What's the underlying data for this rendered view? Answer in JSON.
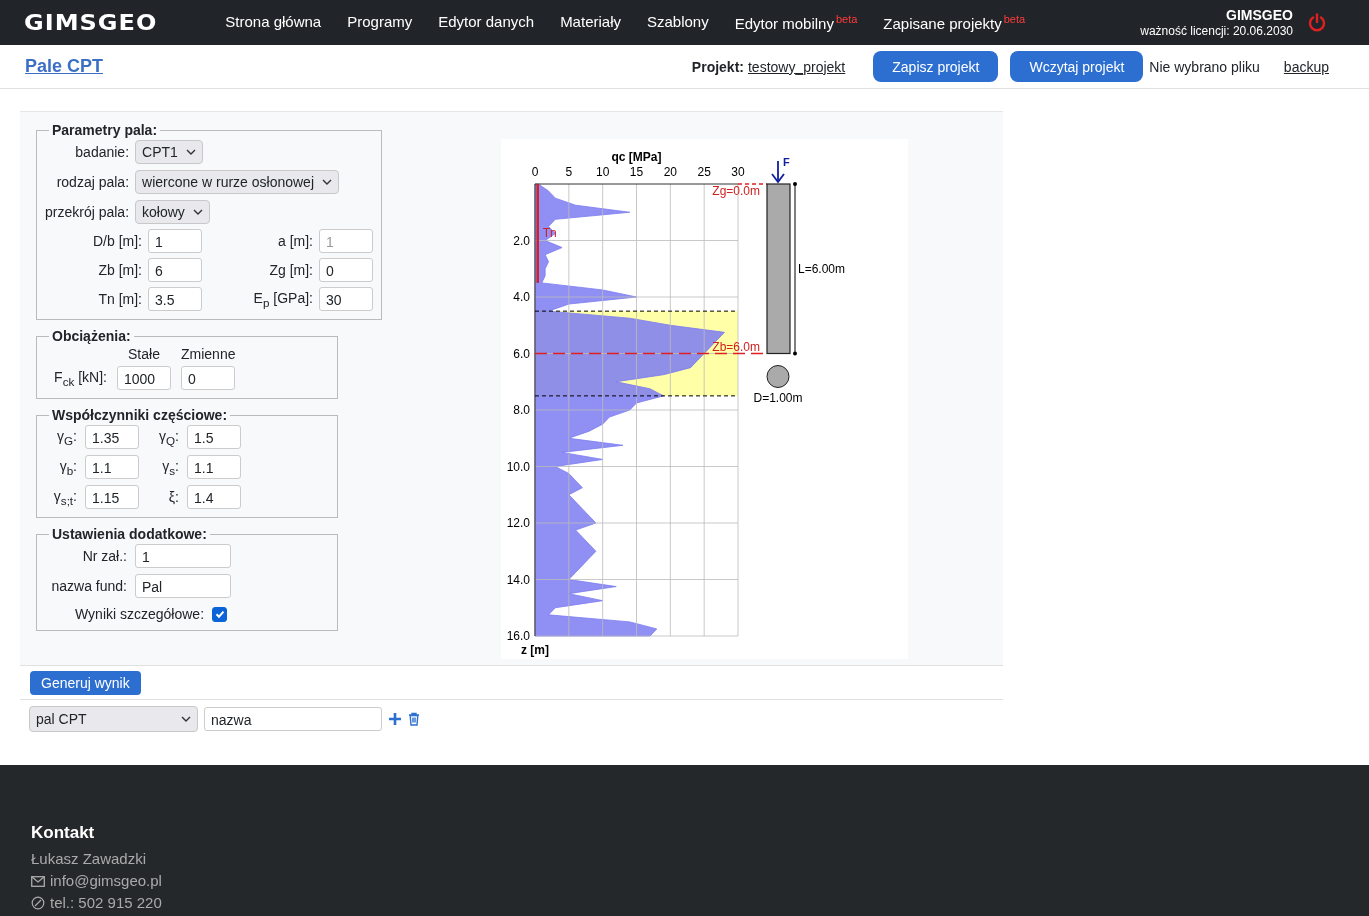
{
  "header": {
    "logo": "GIMSGEO",
    "nav": [
      {
        "label": "Strona główna"
      },
      {
        "label": "Programy"
      },
      {
        "label": "Edytor danych"
      },
      {
        "label": "Materiały"
      },
      {
        "label": "Szablony"
      },
      {
        "label": "Edytor mobilny",
        "badge": "beta"
      },
      {
        "label": "Zapisane projekty",
        "badge": "beta"
      }
    ],
    "user": "GIMSGEO",
    "license": "ważność licencji: 20.06.2030"
  },
  "toolbar": {
    "title": "Pale CPT",
    "project_label": "Projekt:",
    "project_name": "testowy_projekt",
    "buttons": [
      "Zapisz projekt",
      "Wczytaj projekt"
    ],
    "file_status": "Nie wybrano pliku",
    "backup_link": "backup"
  },
  "pile_params": {
    "legend": "Parametry pala:",
    "selects": [
      {
        "label": "badanie:",
        "value": "CPT1"
      },
      {
        "label": "rodzaj pala:",
        "value": "wiercone w rurze osłonowej"
      },
      {
        "label": "przekrój pala:",
        "value": "kołowy"
      }
    ],
    "fields": [
      {
        "label": "D/b [m]:",
        "value": "1",
        "disabled": false
      },
      {
        "label": "a [m]:",
        "value": "1",
        "disabled": true
      },
      {
        "label": "Zb [m]:",
        "value": "6",
        "disabled": false
      },
      {
        "label": "Zg [m]:",
        "value": "0",
        "disabled": false
      },
      {
        "label": "Tn [m]:",
        "value": "3.5",
        "disabled": false
      },
      {
        "label": "E$_{p}$ [GPa]:",
        "value": "30",
        "disabled": false
      }
    ]
  },
  "loads": {
    "legend": "Obciążenia:",
    "columns": [
      "Stałe",
      "Zmienne"
    ],
    "label": "F$_{ck}$ [kN]:",
    "values": [
      "1000",
      "0"
    ]
  },
  "factors": {
    "legend": "Współczynniki częściowe:",
    "fields": [
      {
        "label": "γ$_{G}$:",
        "value": "1.35"
      },
      {
        "label": "γ$_{Q}$:",
        "value": "1.5"
      },
      {
        "label": "γ$_{b}$:",
        "value": "1.1"
      },
      {
        "label": "γ$_{s}$:",
        "value": "1.1"
      },
      {
        "label": "γ$_{s;t}$:",
        "value": "1.15"
      },
      {
        "label": "ξ:",
        "value": "1.4"
      }
    ]
  },
  "extra": {
    "legend": "Ustawienia dodatkowe:",
    "fields": [
      {
        "label": "Nr zał.:",
        "value": "1"
      },
      {
        "label": "nazwa fund:",
        "value": "Pal"
      }
    ],
    "checkbox": {
      "label": "Wyniki szczegółowe:",
      "checked": true
    }
  },
  "generate_button": "Generuj wynik",
  "saved_results": {
    "select": "pal CPT",
    "name": "nazwa"
  },
  "chart": {
    "chart_data": {
      "type": "area",
      "orientation": "horizontal",
      "xlabel": "qc [MPa]",
      "ylabel": "z [m]",
      "x": [
        0,
        0.25,
        0.5,
        0.75,
        1,
        1.25,
        1.5,
        1.75,
        2,
        2.25,
        2.5,
        2.75,
        3,
        3.25,
        3.5,
        3.75,
        4,
        4.25,
        4.5,
        4.75,
        5,
        5.25,
        5.5,
        5.75,
        6,
        6.25,
        6.5,
        6.75,
        7,
        7.25,
        7.5,
        7.75,
        8,
        8.25,
        8.5,
        8.75,
        9,
        9.25,
        9.5,
        9.75,
        10,
        10.25,
        10.5,
        10.75,
        11,
        11.25,
        11.5,
        11.75,
        12,
        12.25,
        12.5,
        12.75,
        13,
        13.25,
        13.5,
        13.75,
        14,
        14.25,
        14.5,
        14.75,
        15,
        15.25,
        15.5,
        15.75,
        16
      ],
      "series": [
        {
          "color": "#7b7bf2",
          "values": [
            0.5,
            2,
            3,
            6,
            14,
            3,
            2,
            3,
            1.5,
            4,
            1.5,
            2,
            1.5,
            1.5,
            1,
            10,
            15,
            5,
            2,
            14,
            20,
            28,
            27,
            26,
            25,
            24,
            23,
            19,
            12,
            17,
            19,
            15,
            14,
            11,
            10,
            8,
            5,
            13,
            4,
            10,
            3,
            5,
            6,
            7,
            5,
            6,
            7,
            8,
            9,
            6,
            7,
            8,
            9,
            8,
            7,
            6,
            5,
            12,
            5,
            10,
            3,
            2,
            14,
            18,
            17
          ]
        },
        {
          "name": "Tn",
          "type": "line",
          "color": "#d0202a",
          "values": [
            0.4,
            0.4,
            0.4,
            0.4,
            0.4,
            0.4,
            0.4,
            0.4,
            0.4,
            0.4,
            0.4,
            0.4,
            0.4,
            0.4,
            0.4,
            null,
            null,
            null,
            null,
            null,
            null,
            null,
            null,
            null,
            null,
            null,
            null,
            null,
            null,
            null,
            null,
            null,
            null,
            null,
            null,
            null,
            null,
            null,
            null,
            null,
            null,
            null,
            null,
            null,
            null,
            null,
            null,
            null,
            null,
            null,
            null,
            null,
            null,
            null,
            null,
            null,
            null,
            null,
            null,
            null,
            null,
            null,
            null,
            null,
            null
          ]
        }
      ],
      "xlim": [
        0,
        30
      ],
      "ylim": [
        16,
        0
      ],
      "xticks": [
        0,
        5,
        10,
        15,
        20,
        25,
        30
      ],
      "yticks": [
        {
          "value": 2,
          "label": "2.0"
        },
        {
          "value": 4,
          "label": "4.0"
        },
        {
          "value": 6,
          "label": "6.0"
        },
        {
          "value": 8,
          "label": "8.0"
        },
        {
          "value": 10,
          "label": "10.0"
        },
        {
          "value": 12,
          "label": "12.0"
        },
        {
          "value": 14,
          "label": "14.0"
        },
        {
          "value": 16,
          "label": "16.0"
        }
      ],
      "grid": true,
      "bands": [
        {
          "axis": "y",
          "from": 4.5,
          "to": 7.5
        }
      ],
      "ref_lines": [
        {
          "axis": "y",
          "value": 0,
          "label": "Zg=0.0m"
        },
        {
          "axis": "y",
          "value": 6,
          "label": "Zb=6.0m"
        },
        {
          "axis": "y",
          "value": 4.5
        },
        {
          "axis": "y",
          "value": 7.5
        }
      ]
    },
    "pile": {
      "force_label": "F",
      "length_label": "L=6.00m",
      "diameter_label": "D=1.00m"
    }
  },
  "footer": {
    "heading": "Kontakt",
    "name": "Łukasz Zawadzki",
    "email": "info@gimsgeo.pl",
    "phone": "tel.: 502 915 220"
  }
}
